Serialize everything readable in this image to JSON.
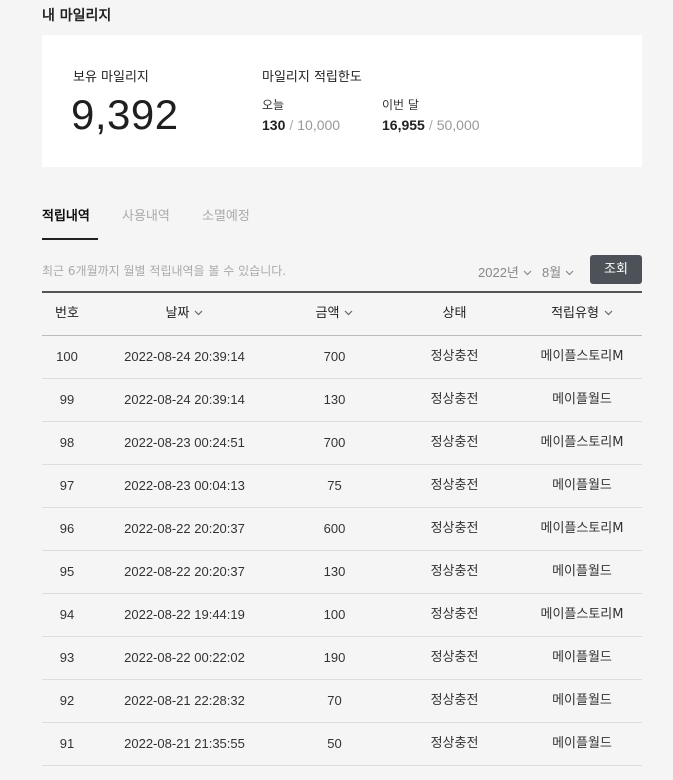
{
  "page_title": "내 마일리지",
  "balance": {
    "label": "보유 마일리지",
    "value": "9,392"
  },
  "limit": {
    "title": "마일리지 적립한도",
    "today": {
      "label": "오늘",
      "used": "130",
      "max": "10,000"
    },
    "month": {
      "label": "이번 달",
      "used": "16,955",
      "max": "50,000"
    },
    "separator": "/"
  },
  "tabs": [
    {
      "label": "적립내역",
      "active": true
    },
    {
      "label": "사용내역",
      "active": false
    },
    {
      "label": "소멸예정",
      "active": false
    }
  ],
  "filter": {
    "note": "최근 6개월까지 월별 적립내역을 볼 수 있습니다.",
    "year": "2022년",
    "month": "8월",
    "search_label": "조회"
  },
  "table": {
    "headers": {
      "no": "번호",
      "date": "날짜",
      "amount": "금액",
      "status": "상태",
      "type": "적립유형"
    },
    "rows": [
      {
        "no": "100",
        "date": "2022-08-24 20:39:14",
        "amount": "700",
        "status": "정상충전",
        "type": "메이플스토리M"
      },
      {
        "no": "99",
        "date": "2022-08-24 20:39:14",
        "amount": "130",
        "status": "정상충전",
        "type": "메이플월드"
      },
      {
        "no": "98",
        "date": "2022-08-23 00:24:51",
        "amount": "700",
        "status": "정상충전",
        "type": "메이플스토리M"
      },
      {
        "no": "97",
        "date": "2022-08-23 00:04:13",
        "amount": "75",
        "status": "정상충전",
        "type": "메이플월드"
      },
      {
        "no": "96",
        "date": "2022-08-22 20:20:37",
        "amount": "600",
        "status": "정상충전",
        "type": "메이플스토리M"
      },
      {
        "no": "95",
        "date": "2022-08-22 20:20:37",
        "amount": "130",
        "status": "정상충전",
        "type": "메이플월드"
      },
      {
        "no": "94",
        "date": "2022-08-22 19:44:19",
        "amount": "100",
        "status": "정상충전",
        "type": "메이플스토리M"
      },
      {
        "no": "93",
        "date": "2022-08-22 00:22:02",
        "amount": "190",
        "status": "정상충전",
        "type": "메이플월드"
      },
      {
        "no": "92",
        "date": "2022-08-21 22:28:32",
        "amount": "70",
        "status": "정상충전",
        "type": "메이플월드"
      },
      {
        "no": "91",
        "date": "2022-08-21 21:35:55",
        "amount": "50",
        "status": "정상충전",
        "type": "메이플월드"
      }
    ]
  },
  "icons": {
    "sort": "chevron-down-icon",
    "select": "chevron-down-icon"
  },
  "colors": {
    "search_button": "#4d5158",
    "card_background": "#ffffff",
    "page_background": "#f5f5f5"
  }
}
